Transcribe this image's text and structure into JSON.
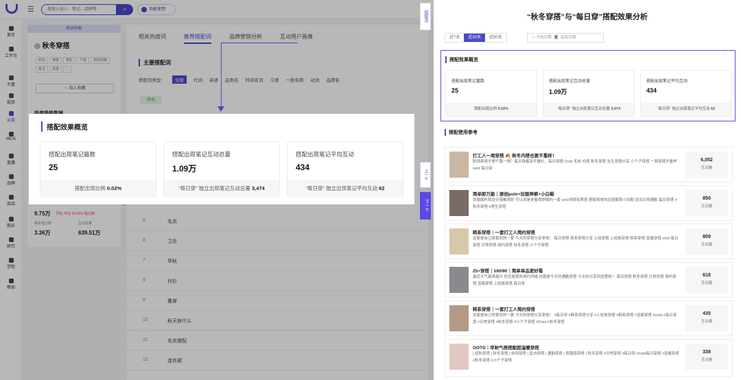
{
  "left_app": {
    "topbar": {
      "search_placeholder": "搜索入达人、笔记、品牌等",
      "pill_label": "功能使用"
    },
    "nav": [
      {
        "label": "首页",
        "icon": "home-icon"
      },
      {
        "label": "工作台",
        "icon": "workbench-icon"
      },
      {
        "label": "大盘",
        "icon": "market-icon"
      },
      {
        "label": "投放",
        "icon": "ads-icon"
      },
      {
        "label": "云投",
        "icon": "cloud-icon",
        "active": true
      },
      {
        "label": "MCN",
        "icon": "mcn-icon"
      },
      {
        "label": "直播",
        "icon": "live-icon"
      },
      {
        "label": "品牌",
        "icon": "brand-icon"
      },
      {
        "label": "商品",
        "icon": "goods-icon"
      },
      {
        "label": "购买",
        "icon": "cart-icon"
      },
      {
        "label": "研究",
        "icon": "research-icon"
      },
      {
        "label": "学院",
        "icon": "academy-icon"
      },
      {
        "label": "帮助",
        "icon": "help-icon"
      }
    ],
    "leftcol": {
      "header": "热词分析",
      "title": "◎ 秋冬穿搭",
      "tags": [
        "时尚",
        "穿搭",
        "宽松",
        "个性",
        "简约风格",
        "复古",
        "百搭",
        "..."
      ],
      "add_button": "☆ 加入收藏",
      "section": "热度趋势数据"
    },
    "stat_block": {
      "big": "9.75万",
      "note": "同比 环比 24.95% 笔记数",
      "label1": "相关笔记数",
      "label2": "互动总量",
      "value1": "3.36万",
      "value2": "639.51万"
    },
    "main": {
      "tabs": [
        "相关热搜词",
        "推荐搭配词",
        "品牌营销分析",
        "互动用户画像"
      ],
      "active_tab": 1,
      "section_title": "主要搭配词",
      "filter_label": "搭配词类型：",
      "filters": [
        "全部",
        "代词",
        "英语",
        "品类名",
        "时间名词",
        "习语",
        "一般名称",
        "动词",
        "品牌名"
      ],
      "export": "导出",
      "rows": [
        {
          "num": "6",
          "word": "毛衣"
        },
        {
          "num": "8",
          "word": "卫衣"
        },
        {
          "num": "7",
          "word": "早秋"
        },
        {
          "num": "9",
          "word": "衬衫"
        },
        {
          "num": "8",
          "word": "叠穿"
        },
        {
          "num": "10",
          "word": "秋天穿什么"
        },
        {
          "num": "11",
          "word": "毛衣搭配"
        },
        {
          "num": "12",
          "word": "连衣裙"
        }
      ]
    },
    "popup": {
      "title": "搭配效果概览",
      "cards": [
        {
          "label": "搭配出现笔记篇数",
          "value": "25",
          "foot_prefix": "搭配出现比例",
          "foot_value": "0.02%"
        },
        {
          "label": "搭配出现笔记互动总量",
          "value": "1.09万",
          "foot_prefix": "“每日穿” 独立出现笔记互动总量",
          "foot_value": "3,474"
        },
        {
          "label": "搭配出现笔记平均互动",
          "value": "434",
          "foot_prefix": "“每日穿” 独立出现笔记平均互动",
          "foot_value": "62"
        }
      ]
    },
    "side_buttons": {
      "top": "搭配词",
      "up": "上一个",
      "down": "下一个"
    }
  },
  "right": {
    "title": "“秋冬穿搭”与“每日穿”搭配效果分析",
    "ranges": [
      "近7天",
      "近30天",
      "近90天"
    ],
    "active_range": 1,
    "date_start": "开始日期",
    "date_sep": "至",
    "date_end": "结束日期",
    "overview": {
      "title": "搭配效果概览",
      "cards": [
        {
          "label": "搭配出现笔记篇数",
          "value": "25",
          "foot_prefix": "搭配出现比例",
          "foot_value": "0.02%"
        },
        {
          "label": "搭配出现笔记互动总量",
          "value": "1.09万",
          "foot_prefix": "“每日穿” 独立出现笔记互动总量",
          "foot_value": "3,474"
        },
        {
          "label": "搭配出现笔记平均互动",
          "value": "434",
          "foot_prefix": "“每日穿” 独立出现笔记平均互动",
          "foot_value": "62"
        }
      ]
    },
    "ref_title": "搭配使用参考",
    "notes": [
      {
        "title": "打工人一周穿搭 🍂 秋冬内搭也要不重样！",
        "text": "职场穿搭不想千篇一律？每天换着穿不撞衫，每日穿搭 Ootd 毛衣 内搭 秋冬穿搭 女生穿搭分享 小个子穿搭 一周穿搭不重样 ootd 每日穿",
        "value": "6,052",
        "label": "互动量"
      },
      {
        "title": "简单即万能｜原创polo+拉链神裤+小白鞋",
        "text": "衣服面料和设计感都很好 可以说是穿着很舒服的一套 polo领很有质感 搭配简单的拉链裤和小白鞋 适合日常通勤 每日穿搭 #秋冬穿搭 #男生穿搭",
        "value": "850",
        "label": "互动量"
      },
      {
        "title": "韩系穿搭｜一套打工人简约穿搭",
        "text": "这套是自己很喜欢的一套 今天的穿搭分享来啦！ 每日穿搭 韩系穿搭分享 上班穿搭 上班族穿搭 韩系穿搭 显瘦穿搭 ootd 每日穿搭 日常穿搭 简约穿搭 秋冬穿搭 小个子穿搭",
        "value": "809",
        "label": "互动量"
      },
      {
        "title": "25+穿搭｜160/90｜简单单品更好看",
        "text": "最近天气越来越冷 但还是喜欢简约风格 这套是今天的通勤穿搭 今天的分享到这里啦～ 每日穿搭 秋冬穿搭 日常穿搭 简约穿搭 显瘦穿搭 上班族穿搭 每日穿",
        "value": "618",
        "label": "互动量"
      },
      {
        "title": "韩系穿搭｜一套打工人简约穿搭",
        "text": "这套是自己很喜欢的一套 今天的穿搭分享来啦！ #每日穿 #韩系穿搭分享 #上班族穿搭 #韩系穿搭 #显瘦穿搭 #ootd #每日穿搭 #日常穿搭 #秋冬穿搭 #小个子穿搭 #Ootd #秋冬穿搭",
        "value": "435",
        "label": "互动量"
      },
      {
        "title": "OOTD｜早秋气质搭配超温暖穿搭",
        "text": "| 初秋穿搭 | 秋冬穿搭 | 休闲穿搭 | 显白穿搭 | 通勤穿搭 | 氛围感穿搭 | 秋天穿搭 #日常穿搭 #每日穿 #ootd每日穿搭 #显瘦穿搭 #秋冬穿搭 #小个子穿搭",
        "value": "338",
        "label": "互动量"
      }
    ]
  }
}
